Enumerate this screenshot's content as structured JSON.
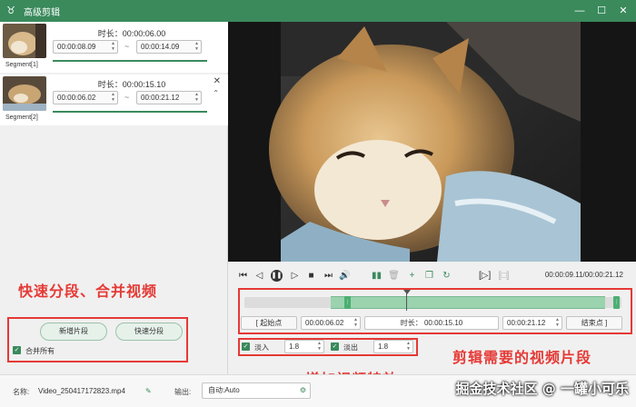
{
  "window": {
    "title": "高级剪辑",
    "minimize": "—",
    "maximize": "☐",
    "close": "✕"
  },
  "segments": [
    {
      "label": "Segment[1]",
      "duration_label": "时长：00:00:06.00",
      "start": "00:00:08.09",
      "end": "00:00:14.09"
    },
    {
      "label": "Segment[2]",
      "duration_label": "时长：00:00:15.10",
      "start": "00:00:06.02",
      "end": "00:00:21.12"
    }
  ],
  "annotations": {
    "split_merge": "快速分段、合并视频",
    "edit_segment": "剪辑需要的视频片段",
    "add_effects": "增加视频特效"
  },
  "actions": {
    "add_segment": "新增片段",
    "quick_split": "快速分段",
    "merge_all": "合并所有"
  },
  "player": {
    "time_display": "00:00:09.11/00:00:21.12",
    "start_point_label": "起始点",
    "start_value": "00:00:06.02",
    "duration_label": "时长：",
    "duration_value": "00:00:15.10",
    "end_value": "00:00:21.12",
    "end_point_label": "结束点",
    "fade_in_label": "淡入",
    "fade_in_value": "1.8",
    "fade_out_label": "淡出",
    "fade_out_value": "1.8"
  },
  "bottom": {
    "name_label": "名称:",
    "name_value": "Video_250417172823.mp4",
    "output_label": "输出:",
    "output_value": "自动:Auto"
  },
  "watermark": "掘金技术社区 @ 一罐小可乐",
  "colors": {
    "accent": "#3a8a5c",
    "annotation": "#e53935"
  }
}
